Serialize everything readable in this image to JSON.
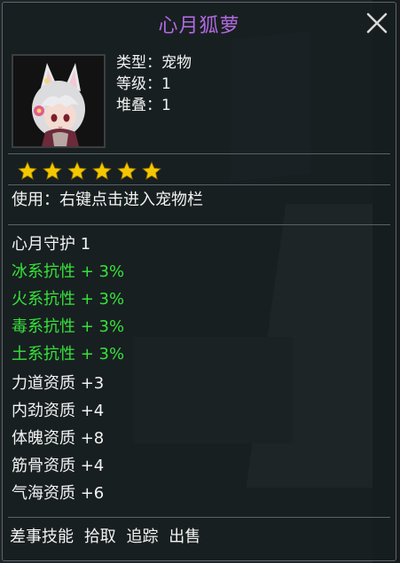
{
  "colors": {
    "title": "#b06ae0",
    "text": "#f2f2f2",
    "bonus": "#36e23a",
    "star": "#f3c800"
  },
  "item": {
    "name": "心月狐萝",
    "type_label": "类型：宠物",
    "level_label": "等级：1",
    "stack_label": "堆叠：1",
    "star_count": 6,
    "usage": "使用：右键点击进入宠物栏"
  },
  "attributes": {
    "skill": "心月守护   1",
    "resistances": [
      "冰系抗性 + 3%",
      "火系抗性 + 3%",
      "毒系抗性 + 3%",
      "土系抗性 + 3%"
    ],
    "aptitudes": [
      "力道资质 +3",
      "内劲资质 +4",
      "体魄资质 +8",
      "筋骨资质 +4",
      "气海资质 +6"
    ]
  },
  "footer": {
    "errand_label": "差事技能",
    "actions": [
      "拾取",
      "追踪",
      "出售"
    ]
  },
  "icons": {
    "close": "close-icon",
    "star": "star-icon",
    "portrait": "pet-portrait"
  }
}
